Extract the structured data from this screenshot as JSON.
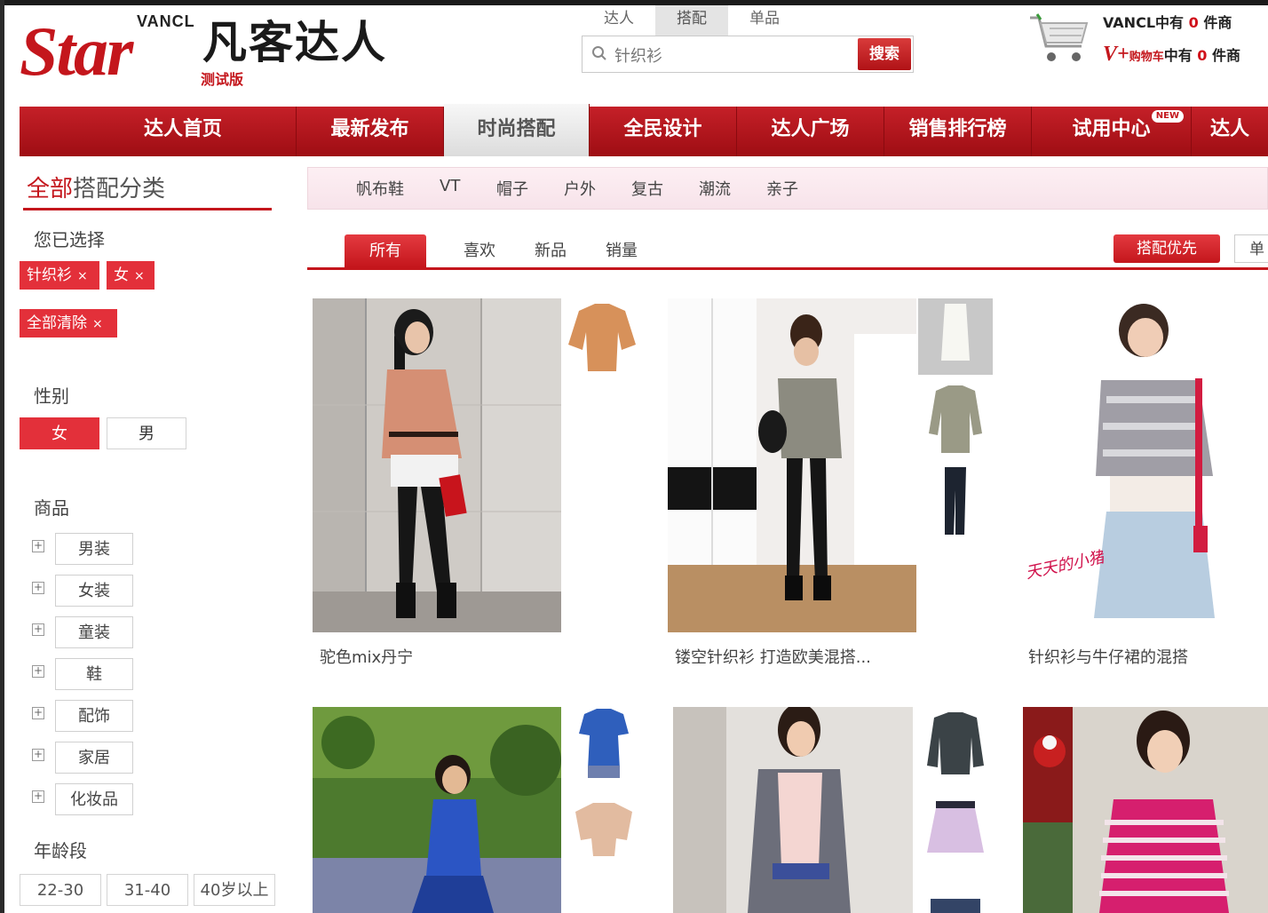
{
  "header": {
    "logo_vancl": "VANCL",
    "logo_star": "Star",
    "logo_cn": "凡客达人",
    "logo_beta": "测试版",
    "search_tabs": [
      "达人",
      "搭配",
      "单品"
    ],
    "search_value": "针织衫",
    "search_button": "搜索",
    "cart_line1_brand": "VANCL",
    "cart_line1_text": "中有",
    "cart_line1_count": "0",
    "cart_line1_suffix": "件商",
    "cart_line2_brand": "V+",
    "cart_line2_label": "购物车",
    "cart_line2_text": "中有",
    "cart_line2_count": "0",
    "cart_line2_suffix": "件商"
  },
  "nav": {
    "items": [
      "达人首页",
      "最新发布",
      "时尚搭配",
      "全民设计",
      "达人广场",
      "销售排行榜",
      "试用中心",
      "达人"
    ],
    "new_badge": "NEW"
  },
  "sidebar": {
    "title_red": "全部",
    "title_rest": "搭配分类",
    "selected_label": "您已选择",
    "tags": [
      "针织衫",
      "女"
    ],
    "clear_all": "全部清除",
    "tag_close": "×",
    "gender_label": "性别",
    "gender_options": [
      "女",
      "男"
    ],
    "goods_label": "商品",
    "categories": [
      "男装",
      "女装",
      "童装",
      "鞋",
      "配饰",
      "家居",
      "化妆品"
    ],
    "expand_glyph": "+",
    "age_label": "年龄段",
    "age_options": [
      "22-30",
      "31-40",
      "40岁以上"
    ]
  },
  "main": {
    "subnav": [
      "帆布鞋",
      "VT",
      "帽子",
      "户外",
      "复古",
      "潮流",
      "亲子"
    ],
    "sort_tabs": [
      "所有",
      "喜欢",
      "新品",
      "销量"
    ],
    "priority_button": "搭配优先",
    "single_button": "单",
    "outfits": [
      {
        "caption": "驼色mix丹宁"
      },
      {
        "caption": "镂空针织衫 打造欧美混搭..."
      },
      {
        "caption": "针织衫与牛仔裙的混搭",
        "photo_watermark": "天天的小猪"
      },
      {
        "caption": ""
      },
      {
        "caption": ""
      },
      {
        "caption": ""
      }
    ]
  }
}
